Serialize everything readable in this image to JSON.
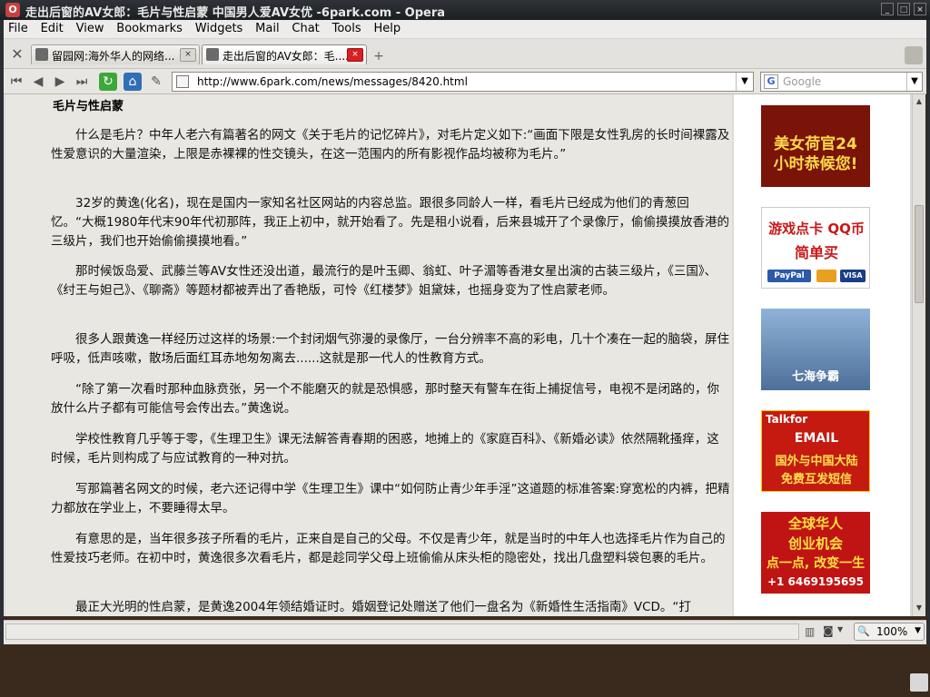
{
  "window": {
    "title": "走出后窗的AV女郎：毛片与性启蒙 中国男人爱AV女优 -6park.com - Opera"
  },
  "menu": {
    "items": [
      "File",
      "Edit",
      "View",
      "Bookmarks",
      "Widgets",
      "Mail",
      "Chat",
      "Tools",
      "Help"
    ]
  },
  "tabs": [
    {
      "label": "留园网:海外华人的网络...",
      "active": false
    },
    {
      "label": "走出后窗的AV女郎：毛.....",
      "active": true
    }
  ],
  "address": {
    "url": "http://www.6park.com/news/messages/8420.html"
  },
  "search": {
    "placeholder": "Google"
  },
  "article": {
    "heading": "毛片与性启蒙",
    "paragraphs": [
      "什么是毛片？中年人老六有篇著名的网文《关于毛片的记忆碎片》，对毛片定义如下:“画面下限是女性乳房的长时间裸露及性爱意识的大量渲染，上限是赤裸裸的性交镜头，在这一范围内的所有影视作品均被称为毛片。”",
      "32岁的黄逸(化名)，现在是国内一家知名社区网站的内容总监。跟很多同龄人一样，看毛片已经成为他们的青葱回忆。“大概1980年代末90年代初那阵，我正上初中，就开始看了。先是租小说看，后来县城开了个录像厅，偷偷摸摸放香港的三级片，我们也开始偷偷摸摸地看。”",
      "那时候饭岛爱、武藤兰等AV女性还没出道，最流行的是叶玉卿、翁虹、叶子湄等香港女星出演的古装三级片，《三国》、《纣王与妲己》、《聊斋》等题材都被弄出了香艳版，可怜《红楼梦》姐黛妹，也摇身变为了性启蒙老师。",
      "很多人跟黄逸一样经历过这样的场景:一个封闭烟气弥漫的录像厅，一台分辨率不高的彩电，几十个凑在一起的脑袋，屏住呼吸，低声咳嗽，散场后面红耳赤地匆匆离去......这就是那一代人的性教育方式。",
      "“除了第一次看时那种血脉贲张，另一个不能磨灭的就是恐惧感，那时整天有警车在街上捕捉信号，电视不是闭路的，你放什么片子都有可能信号会传出去。”黄逸说。",
      "学校性教育几乎等于零，《生理卫生》课无法解答青春期的困惑，地摊上的《家庭百科》、《新婚必读》依然隔靴搔痒，这时候，毛片则构成了与应试教育的一种对抗。",
      "写那篇著名网文的时候，老六还记得中学《生理卫生》课中“如何防止青少年手淫”这道题的标准答案:穿宽松的内裤，把精力都放在学业上，不要睡得太早。",
      "有意思的是，当年很多孩子所看的毛片，正来自是自己的父母。不仅是青少年，就是当时的中年人也选择毛片作为自己的性爱技巧老师。在初中时，黄逸很多次看毛片，都是趁同学父母上班偷偷从床头柜的隐密处，找出几盘塑料袋包裹的毛片。",
      "最正大光明的性启蒙，是黄逸2004年领结婚证时。婚姻登记处赠送了他们一盘名为《新婚性生活指南》VCD。“打"
    ]
  },
  "ads": [
    {
      "lines": [
        "美女荷官24",
        "小时恭候您!"
      ],
      "bg": "#7a1408",
      "fg": "#ffd84a"
    },
    {
      "lines": [
        "游戏点卡 QQ币",
        "简单买"
      ],
      "bg": "#ffffff",
      "fg": "#c81818",
      "extra": [
        "PayPal",
        "VISA"
      ]
    },
    {
      "lines": [
        "七海争霸"
      ],
      "bg": "#5c86b8",
      "fg": "#ffffff"
    },
    {
      "lines": [
        "Talkfor",
        "EMAIL",
        "国外与中国大陆",
        "免费互发短信"
      ],
      "bg": "#c41a10",
      "fg": "#ffffff"
    },
    {
      "lines": [
        "全球华人",
        "创业机会",
        "点一点, 改变一生",
        "+1 6469195695"
      ],
      "bg": "#c01414",
      "fg": "#ffe040"
    }
  ],
  "status": {
    "zoom": "100%"
  },
  "colors": {
    "accent_red": "#d82020",
    "content_bg": "#e8e7e1",
    "chrome_bg": "#e8e6e2"
  }
}
